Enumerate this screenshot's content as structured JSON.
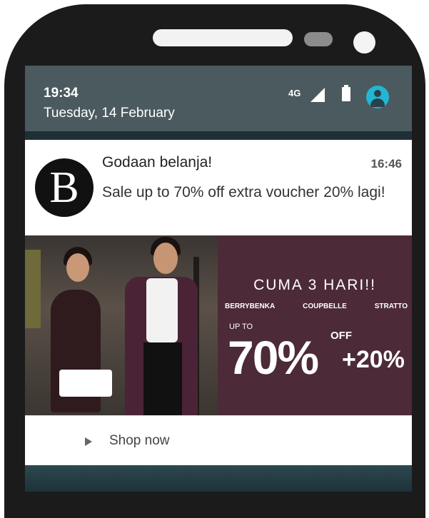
{
  "status_bar": {
    "time": "19:34",
    "date": "Tuesday, 14 February",
    "network": "4G",
    "icons": [
      "signal-icon",
      "battery-icon",
      "account-icon"
    ],
    "account_color": "#23b6d4"
  },
  "notification": {
    "app_logo": "B",
    "title": "Godaan belanja!",
    "time": "16:46",
    "message": "Sale up to 70% off extra voucher 20% lagi!",
    "banner": {
      "headline": "CUMA 3 HARI!!",
      "brands": [
        "BERRYBENKA",
        "COUPBELLE",
        "STRATTO"
      ],
      "up_to": "UP TO",
      "discount": "70%",
      "off": "OFF",
      "extra": "+20%",
      "panel_color": "#4d2a38"
    },
    "action": {
      "label": "Shop now",
      "icon": "play-icon"
    }
  }
}
